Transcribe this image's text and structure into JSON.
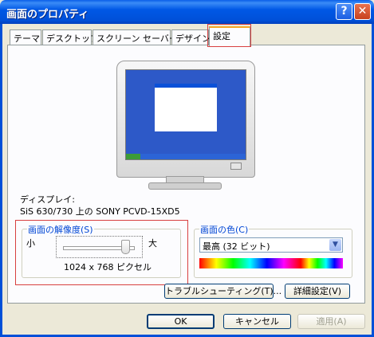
{
  "window": {
    "title": "画面のプロパティ",
    "help_glyph": "?",
    "close_glyph": "✕"
  },
  "tabs": [
    {
      "label": "テーマ"
    },
    {
      "label": "デスクトップ"
    },
    {
      "label": "スクリーン セーバー"
    },
    {
      "label": "デザイン"
    },
    {
      "label": "設定",
      "active": true
    }
  ],
  "display": {
    "label": "ディスプレイ:",
    "value": "SiS 630/730 上の SONY PCVD-15XD5"
  },
  "resolution": {
    "title": "画面の解像度(S)",
    "small_label": "小",
    "large_label": "大",
    "value": "1024 x 768 ピクセル"
  },
  "color_quality": {
    "title": "画面の色(C)",
    "selected": "最高 (32 ビット)"
  },
  "buttons": {
    "troubleshoot": "トラブルシューティング(T)...",
    "advanced": "詳細設定(V)",
    "ok": "OK",
    "cancel": "キャンセル",
    "apply": "適用(A)"
  },
  "colors": {
    "titlebar": "#0050d8",
    "accent_orange": "#f5a623",
    "highlight_red": "#d84040",
    "group_title": "#0046d5"
  }
}
